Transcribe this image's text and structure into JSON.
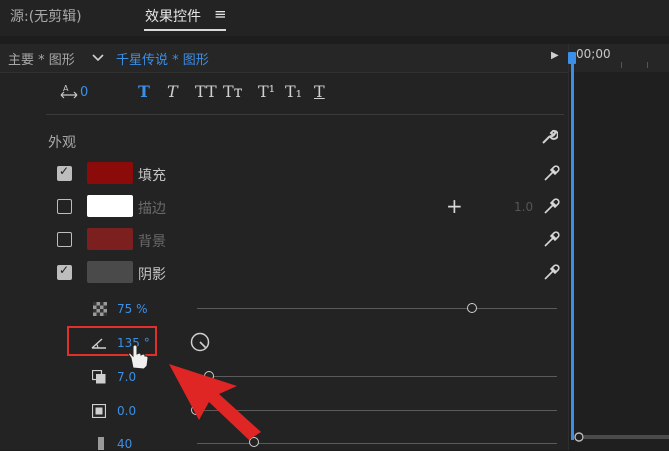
{
  "tabs": {
    "source": "源:(无剪辑)",
    "effects": "效果控件",
    "menu_glyph": "≡"
  },
  "breadcrumb": {
    "master": "主要 * 图形",
    "clip": "千星传说 * 图形"
  },
  "text_tools": {
    "tracking_value": "0",
    "buttons": [
      "T",
      "T",
      "TT",
      "Tт",
      "T¹",
      "T₁",
      "T"
    ]
  },
  "appearance": {
    "label": "外观",
    "rows": [
      {
        "label": "填充",
        "checked": true,
        "color": "#8b0a0a"
      },
      {
        "label": "描边",
        "checked": false,
        "color": "#ffffff",
        "width": "1.0"
      },
      {
        "label": "背景",
        "checked": false,
        "color": "#7c1f1f"
      },
      {
        "label": "阴影",
        "checked": true,
        "color": "#4a4a4a"
      }
    ]
  },
  "shadow": {
    "opacity": "75 %",
    "angle": "135 °",
    "distance": "7.0",
    "size": "0.0",
    "blur": "40"
  },
  "timeline": {
    "time": "00;00"
  },
  "colors": {
    "accent": "#3c8fe6",
    "highlight": "#e0302a",
    "arrow": "#e02525"
  }
}
